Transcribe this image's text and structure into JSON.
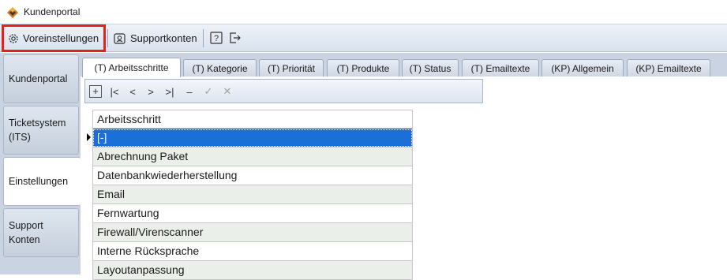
{
  "window": {
    "title": "Kundenportal"
  },
  "toolbar": {
    "preferences_label": "Voreinstellungen",
    "support_accounts_label": "Supportkonten",
    "help_icon": "help-icon",
    "exit_icon": "exit-icon"
  },
  "sidebar": {
    "items": [
      {
        "label_line1": "Kundenportal",
        "label_line2": ""
      },
      {
        "label_line1": "Ticketsystem",
        "label_line2": "(ITS)"
      },
      {
        "label_line1": "Einstellungen",
        "label_line2": ""
      },
      {
        "label_line1": "Support",
        "label_line2": "Konten"
      }
    ],
    "active_index": 2
  },
  "tabs": [
    {
      "label": "(T) Arbeitsschritte"
    },
    {
      "label": "(T) Kategorie"
    },
    {
      "label": "(T) Priorität"
    },
    {
      "label": "(T) Produkte"
    },
    {
      "label": "(T) Status"
    },
    {
      "label": "(T) Emailtexte"
    },
    {
      "label": "(KP) Allgemein"
    },
    {
      "label": "(KP) Emailtexte"
    }
  ],
  "navigator": {
    "add": "+",
    "first": "|<",
    "prev": "<",
    "next": ">",
    "last": ">|",
    "delete": "–",
    "post": "✓",
    "cancel": "✕"
  },
  "grid": {
    "header": "Arbeitsschritt",
    "rows": [
      "[-]",
      "Abrechnung Paket",
      "Datenbankwiederherstellung",
      "Email",
      "Fernwartung",
      "Firewall/Virenscanner",
      "Interne Rücksprache",
      "Layoutanpassung"
    ],
    "selected_index": 0
  },
  "colors": {
    "highlight_border": "#e5201e",
    "selection": "#1a6fd8",
    "chrome": "#c9d3e1"
  }
}
